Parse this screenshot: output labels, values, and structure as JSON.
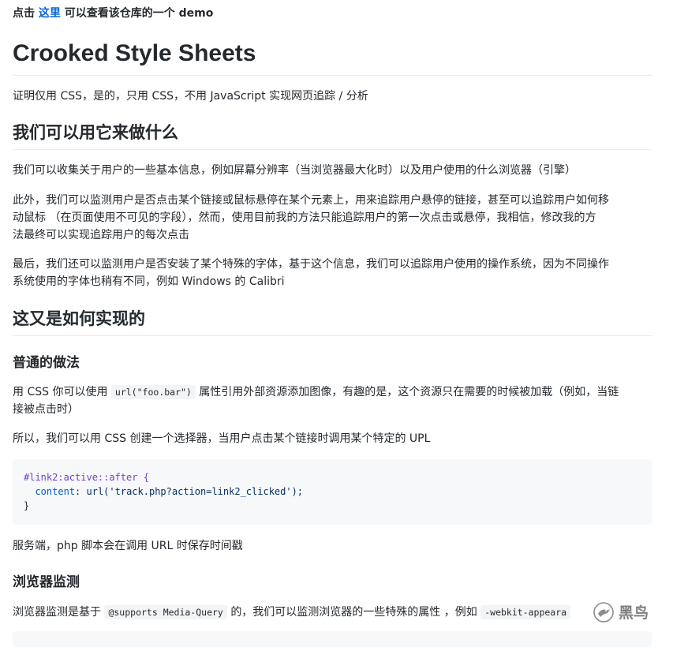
{
  "top_note": {
    "prefix": "点击",
    "link": "这里",
    "suffix": "可以查看该仓库的一个 demo"
  },
  "title": "Crooked Style Sheets",
  "intro": "证明仅用 CSS，是的，只用 CSS，不用 JavaScript 实现网页追踪 / 分析",
  "section1": {
    "heading": "我们可以用它来做什么",
    "p1": "我们可以收集关于用户的一些基本信息，例如屏幕分辨率（当浏览器最大化时）以及用户使用的什么浏览器（引擎）",
    "p2_lines": [
      "此外，我们可以监测用户是否点击某个链接或鼠标悬停在某个元素上，用来追踪用户悬停的链接，甚至可以追踪用户如何移",
      "动鼠标 （在页面使用不可见的字段），然而，使用目前我的方法只能追踪用户的第一次点击或悬停，我相信，修改我的方",
      "法最终可以实现追踪用户的每次点击"
    ],
    "p3_lines": [
      "最后，我们还可以监测用户是否安装了某个特殊的字体，基于这个信息，我们可以追踪用户使用的操作系统，因为不同操作",
      "系统使用的字体也稍有不同，例如 Windows 的 Calibri"
    ]
  },
  "section2": {
    "heading": "这又是如何实现的",
    "sub1": {
      "heading": "普通的做法",
      "p1_pre": "用 CSS 你可以使用",
      "p1_code": "url(\"foo.bar\")",
      "p1_post": "属性引用外部资源添加图像，有趣的是，这个资源只在需要的时候被加载（例如，当链",
      "p1_line2": "接被点击时）",
      "p2": "所以，我们可以用 CSS 创建一个选择器，当用户点击某个链接时调用某个特定的 UPL",
      "code": {
        "selector": "#link2:active::after {",
        "prop": "content",
        "colon": ":",
        "value": "url('track.php?action=link2_clicked');",
        "close": "}"
      },
      "p3": "服务端，php 脚本会在调用 URL 时保存时间戳"
    },
    "sub2": {
      "heading": "浏览器监测",
      "p1_pre": "浏览器监测是基于",
      "p1_code": "@supports Media-Query",
      "p1_mid": "的，我们可以监测浏览器的一些特殊的属性 ，例如",
      "p1_code2": "-webkit-appeara"
    }
  },
  "watermark": {
    "text": "黑鸟"
  },
  "colors": {
    "link": "#0366d6",
    "text": "#24292e",
    "rule": "#eaecef",
    "code_bg": "#f6f8fa"
  }
}
